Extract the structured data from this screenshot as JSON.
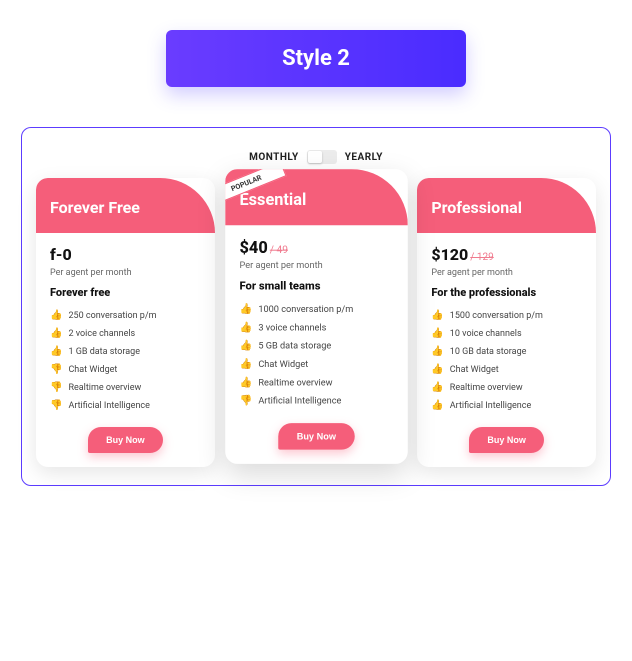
{
  "header": {
    "badge": "Style 2"
  },
  "toggle": {
    "left": "MONTHLY",
    "right": "YEARLY"
  },
  "popular_label": "POPULAR",
  "plans": [
    {
      "title": "Forever Free",
      "price": "f-0",
      "old_price": "",
      "sub": "Per agent per month",
      "tagline": "Forever free",
      "buy": "Buy Now",
      "features": [
        {
          "ok": true,
          "text": "250 conversation p/m"
        },
        {
          "ok": true,
          "text": "2 voice channels"
        },
        {
          "ok": true,
          "text": "1 GB data storage"
        },
        {
          "ok": false,
          "text": "Chat Widget"
        },
        {
          "ok": false,
          "text": "Realtime overview"
        },
        {
          "ok": false,
          "text": "Artificial Intelligence"
        }
      ]
    },
    {
      "title": "Essential",
      "price": "$40",
      "old_price": "/ 49",
      "sub": "Per agent per month",
      "tagline": "For small teams",
      "buy": "Buy Now",
      "features": [
        {
          "ok": true,
          "text": "1000 conversation p/m"
        },
        {
          "ok": true,
          "text": "3 voice channels"
        },
        {
          "ok": true,
          "text": "5 GB data storage"
        },
        {
          "ok": true,
          "text": "Chat Widget"
        },
        {
          "ok": true,
          "text": "Realtime overview"
        },
        {
          "ok": false,
          "text": "Artificial Intelligence"
        }
      ]
    },
    {
      "title": "Professional",
      "price": "$120",
      "old_price": "/ 129",
      "sub": "Per agent per month",
      "tagline": "For the professionals",
      "buy": "Buy Now",
      "features": [
        {
          "ok": true,
          "text": "1500 conversation p/m"
        },
        {
          "ok": true,
          "text": "10 voice channels"
        },
        {
          "ok": true,
          "text": "10 GB data storage"
        },
        {
          "ok": true,
          "text": "Chat Widget"
        },
        {
          "ok": true,
          "text": "Realtime overview"
        },
        {
          "ok": true,
          "text": "Artificial Intelligence"
        }
      ]
    }
  ]
}
